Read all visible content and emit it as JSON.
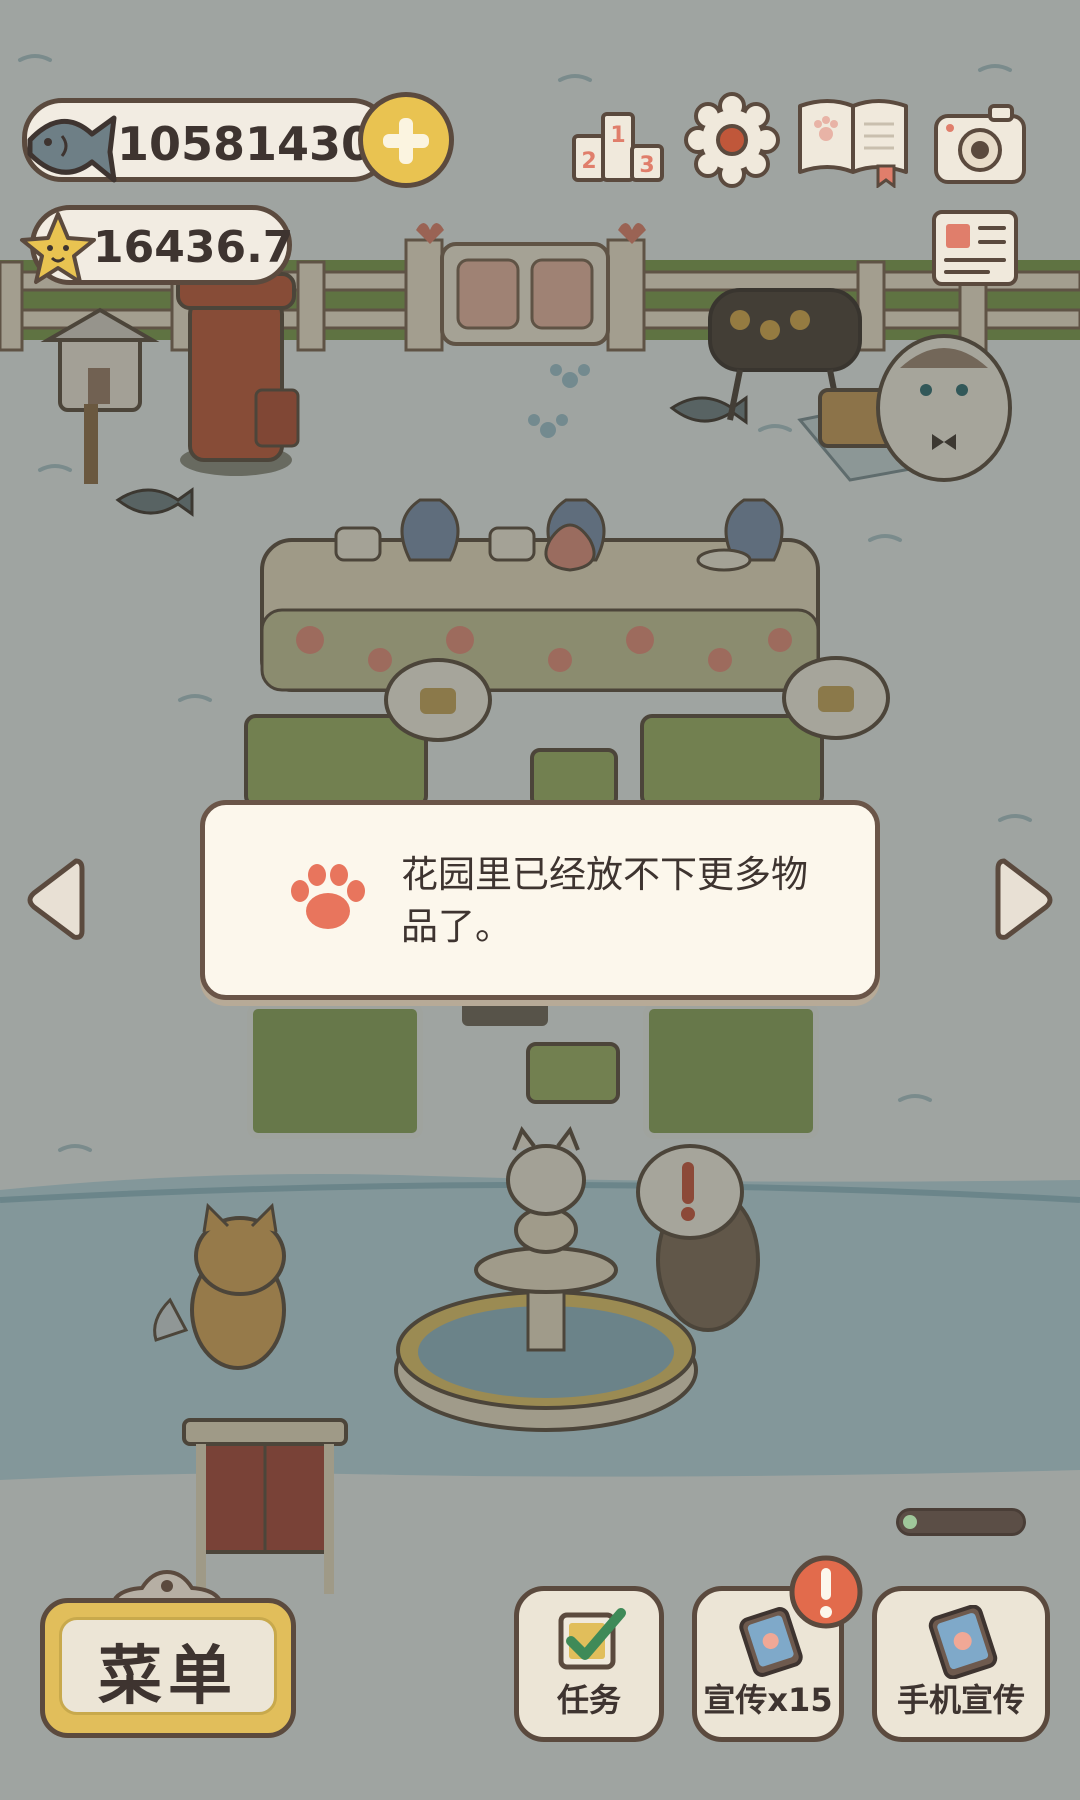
{
  "hud": {
    "fish_count": "10581430",
    "star_count": "16436.7"
  },
  "dialog": {
    "message_line1": "花园里已经放不下更多物",
    "message_line2": "品了。"
  },
  "bottom": {
    "menu_label": "菜单",
    "task_label": "任务",
    "promo_label": "宣传x15",
    "phone_label": "手机宣传",
    "promo_progress": 0.12
  },
  "icons": {
    "fish": "fish-icon",
    "plus": "plus-icon",
    "star": "star-icon",
    "ranking": "ranking-podium-icon",
    "settings": "gear-icon",
    "album": "paw-book-icon",
    "camera": "camera-icon",
    "newspaper": "newspaper-icon",
    "paw": "paw-icon",
    "checkbox": "checkbox-icon",
    "phone": "phone-icon",
    "alert": "exclamation-icon"
  },
  "colors": {
    "accent_yellow": "#e9c351",
    "outline_brown": "#5b4a3e",
    "paper": "#fcf7ec",
    "paw_coral": "#e8755d",
    "alert_red": "#e26b4c"
  }
}
